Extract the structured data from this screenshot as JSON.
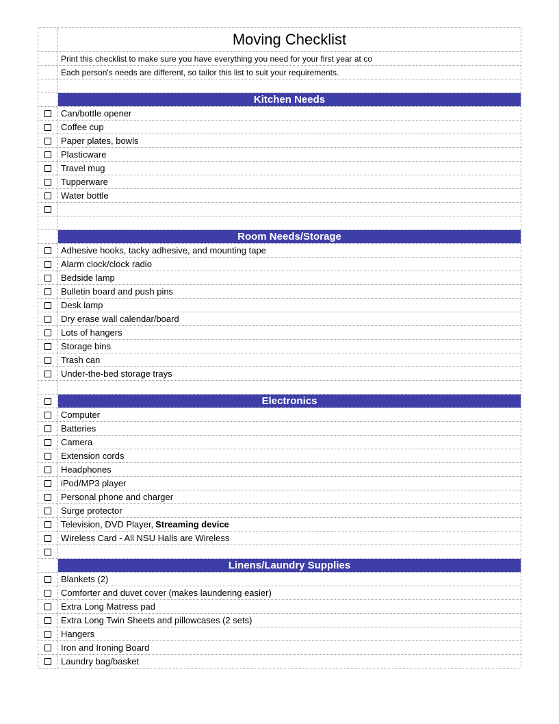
{
  "title": "Moving Checklist",
  "subtitle_line1": "Print this checklist to make sure you have everything you need for your first year at co",
  "subtitle_line2": "Each person's needs are different, so tailor this list to suit your requirements.",
  "sections": [
    {
      "header": "Kitchen Needs",
      "items": [
        "Can/bottle opener",
        "Coffee cup",
        "Paper plates, bowls",
        "Plasticware",
        "Travel mug",
        "Tupperware",
        "Water bottle"
      ],
      "trailing_blank": true,
      "header_has_cb": false
    },
    {
      "header": "Room Needs/Storage",
      "items": [
        "Adhesive hooks, tacky adhesive, and mounting tape",
        "Alarm clock/clock radio",
        "Bedside lamp",
        "Bulletin board and push pins",
        "Desk lamp",
        "Dry erase wall calendar/board",
        "Lots of hangers",
        "Storage bins",
        "Trash can",
        "Under-the-bed storage trays"
      ],
      "trailing_blank": false,
      "header_has_cb": false
    },
    {
      "header": "Electronics",
      "items": [
        "Computer",
        "Batteries",
        "Camera",
        "Extension cords",
        "Headphones",
        "iPod/MP3 player",
        "Personal phone and charger",
        "Surge protector",
        {
          "text": "Television, DVD Player,",
          "bold": "Streaming device"
        },
        "Wireless Card - All NSU Halls are Wireless"
      ],
      "trailing_blank": true,
      "header_has_cb": true
    },
    {
      "header": "Linens/Laundry Supplies",
      "items": [
        "Blankets (2)",
        "Comforter and duvet cover (makes laundering easier)",
        "Extra Long Matress pad",
        "Extra Long Twin Sheets and pillowcases (2 sets)",
        "Hangers",
        "Iron and Ironing Board",
        "Laundry bag/basket"
      ],
      "trailing_blank": false,
      "header_has_cb": false,
      "no_spacer_before": true
    }
  ]
}
